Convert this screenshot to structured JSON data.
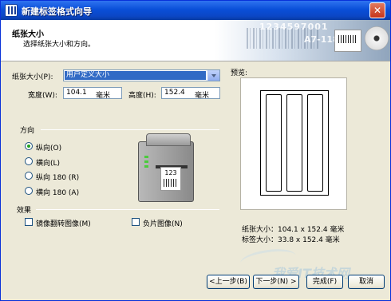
{
  "window": {
    "title": "新建标签格式向导"
  },
  "header": {
    "title": "纸张大小",
    "subtitle": "选择纸张大小和方向。",
    "art_num1": "1234597001",
    "art_num2": "A7-118"
  },
  "paper_size": {
    "label": "纸张大小(P):",
    "selected": "用户定义大小",
    "width_label": "宽度(W):",
    "width_value": "104.1",
    "width_unit": "毫米",
    "height_label": "高度(H):",
    "height_value": "152.4",
    "height_unit": "毫米"
  },
  "orientation": {
    "label": "方向",
    "options": [
      "纵向(O)",
      "横向(L)",
      "纵向 180 (R)",
      "横向 180 (A)"
    ],
    "selected_index": 0
  },
  "printer_label_text": "123",
  "effects": {
    "label": "效果",
    "mirror": "镜像翻转图像(M)",
    "negative": "负片图像(N)"
  },
  "preview": {
    "label": "预览:",
    "paper_size_text": "纸张大小：104.1 x 152.4  毫米",
    "label_size_text": "标签大小：33.8 x 152.4  毫米",
    "strip_count": 3
  },
  "buttons": {
    "back": "<上一步(B)",
    "next": "下一步(N) >",
    "finish": "完成(F)",
    "cancel": "取消"
  },
  "watermark": "我爱IT技术网",
  "colors": {
    "titlebar": "#0a4fd8",
    "selection": "#316ac5",
    "radio_dot": "#21a121"
  }
}
